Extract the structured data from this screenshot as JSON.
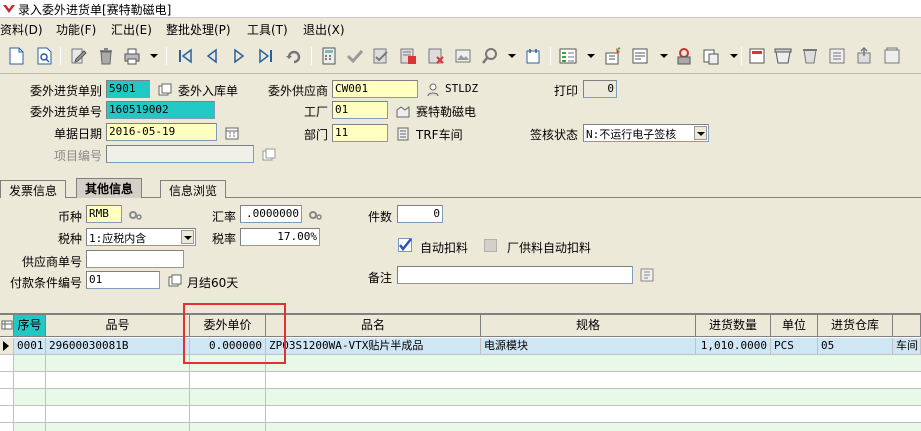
{
  "window": {
    "title": "录入委外进货单[赛特勒磁电]"
  },
  "menu": [
    {
      "label": "资料(D)"
    },
    {
      "label": "功能(F)"
    },
    {
      "label": "汇出(E)"
    },
    {
      "label": "整批处理(P)"
    },
    {
      "label": "工具(T)"
    },
    {
      "label": "退出(X)"
    }
  ],
  "toolbar": {
    "icons": [
      "new-doc-icon",
      "search-doc-icon",
      "edit-icon",
      "delete-icon",
      "print-icon",
      "first-record-icon",
      "prev-record-icon",
      "next-record-icon",
      "last-record-icon",
      "refresh-icon",
      "calculator-icon",
      "approve-check-icon",
      "audit-icon",
      "cancel-audit-icon",
      "image-icon",
      "find-icon",
      "info-icon",
      "transfer-icon",
      "settings-icon",
      "list-icon",
      "printer-setup-icon",
      "delete-row-icon",
      "copy-doc-icon",
      "archive-icon",
      "print-preview-icon",
      "export-icon"
    ]
  },
  "header": {
    "order_type_label": "委外进货单别",
    "order_type_value": "5901",
    "order_type_desc": "委外入库单",
    "order_no_label": "委外进货单号",
    "order_no_value": "160519002",
    "doc_date_label": "单据日期",
    "doc_date_value": "2016-05-19",
    "project_no_label": "项目编号",
    "project_no_value": "",
    "supplier_label": "委外供应商",
    "supplier_value": "CW001",
    "supplier_desc": "STLDZ",
    "factory_label": "工厂",
    "factory_value": "01",
    "factory_desc": "赛特勒磁电",
    "dept_label": "部门",
    "dept_value": "11",
    "dept_desc": "TRF车间",
    "print_label": "打印",
    "print_value": "0",
    "sign_status_label": "签核状态",
    "sign_status_value": "N:不运行电子签核"
  },
  "tabs": [
    {
      "label": "发票信息"
    },
    {
      "label": "其他信息"
    },
    {
      "label": "信息浏览"
    }
  ],
  "detail": {
    "currency_label": "币种",
    "currency_value": "RMB",
    "exchange_rate_label": "汇率",
    "exchange_rate_value": ".0000000",
    "pieces_label": "件数",
    "pieces_value": "0",
    "tax_type_label": "税种",
    "tax_type_value": "1:应税内含",
    "tax_rate_label": "税率",
    "tax_rate_value": "17.00%",
    "auto_deduct_label": "自动扣料",
    "auto_deduct_checked": true,
    "vendor_auto_deduct_label": "厂供料自动扣料",
    "vendor_auto_deduct_checked": false,
    "supplier_doc_label": "供应商单号",
    "supplier_doc_value": "",
    "payment_terms_label": "付款条件编号",
    "payment_terms_value": "01",
    "payment_terms_desc": "月结60天",
    "remark_label": "备注",
    "remark_value": ""
  },
  "grid": {
    "columns": [
      "序号",
      "品号",
      "委外单价",
      "品名",
      "规格",
      "进货数量",
      "单位",
      "进货仓库",
      ""
    ],
    "rows": [
      {
        "seq": "0001",
        "item_no": "29600030081B",
        "unit_price": "0.000000",
        "item_name": "ZP03S1200WA-VTX贴片半成品",
        "spec": "电源模块",
        "qty": "1,010.0000",
        "unit": "PCS",
        "warehouse": "05",
        "extra": "车间"
      }
    ]
  },
  "colors": {
    "highlight": "#e53030",
    "teal_field": "#22c9c4",
    "yellow_field": "#ffffc0",
    "selected_row": "#cfe6f5",
    "alt_row": "#e9f9e9"
  }
}
